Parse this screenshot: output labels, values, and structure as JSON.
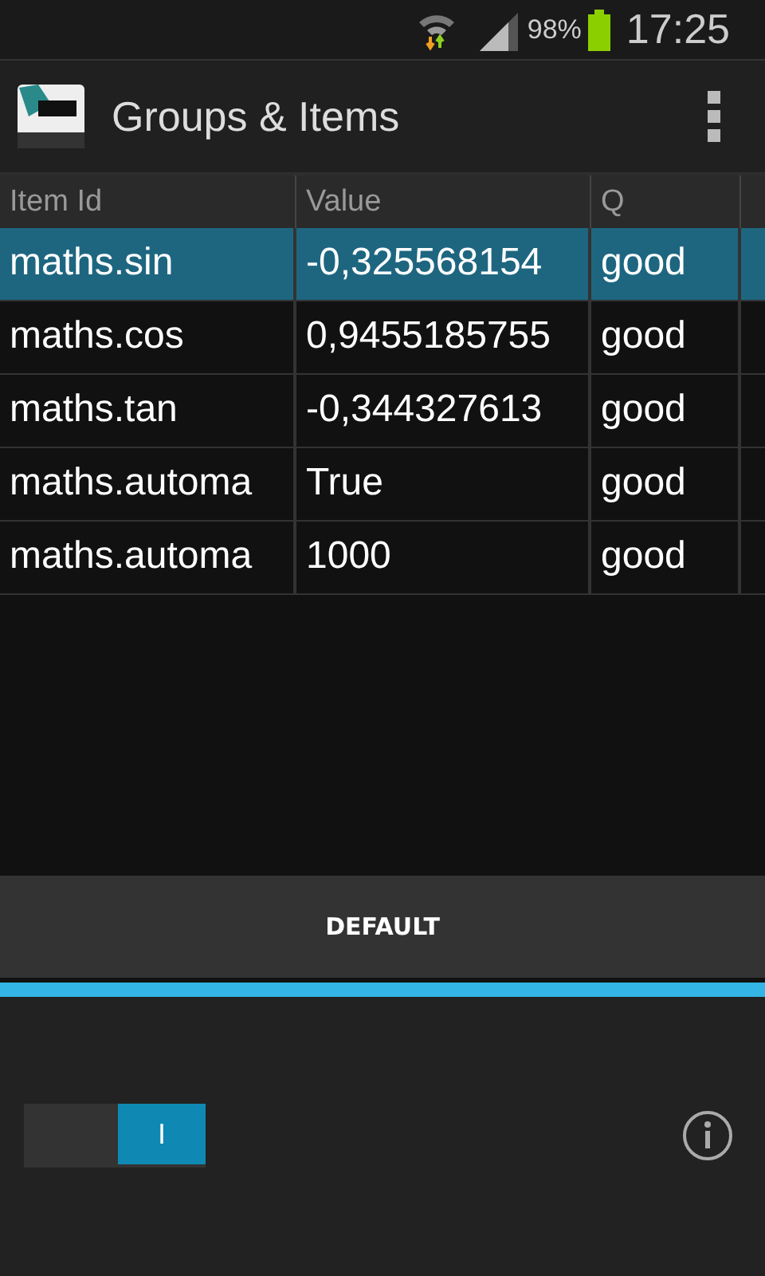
{
  "status_bar": {
    "battery": "98%",
    "time": "17:25"
  },
  "action_bar": {
    "title": "Groups & Items"
  },
  "table": {
    "columns": [
      "Item Id",
      "Value",
      "Q"
    ],
    "rows": [
      {
        "cells": [
          "maths.sin",
          "-0,325568154",
          "good"
        ],
        "selected": true
      },
      {
        "cells": [
          "maths.cos",
          "0,9455185755",
          "good"
        ],
        "selected": false
      },
      {
        "cells": [
          "maths.tan",
          "-0,344327613",
          "good"
        ],
        "selected": false
      },
      {
        "cells": [
          "maths.automa",
          "True",
          "good"
        ],
        "selected": false
      },
      {
        "cells": [
          "maths.automa",
          "1000",
          "good"
        ],
        "selected": false
      }
    ]
  },
  "default_button": "DEFAULT",
  "toggle": {
    "label": "I",
    "on": true
  }
}
